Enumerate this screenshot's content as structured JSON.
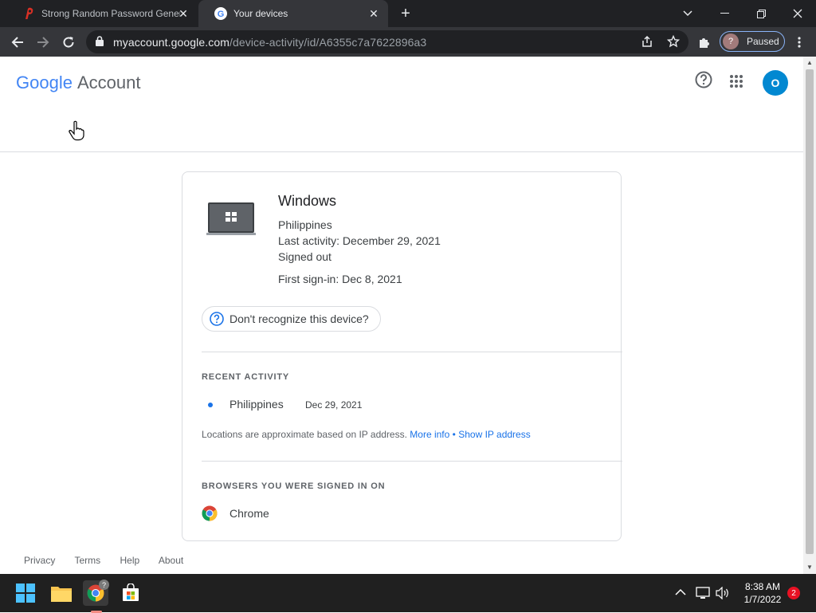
{
  "browser": {
    "tabs": [
      {
        "title": "Strong Random Password Generator",
        "active": false
      },
      {
        "title": "Your devices",
        "active": true
      }
    ],
    "url_host": "myaccount.google.com",
    "url_path": "/device-activity/id/A6355c7a7622896a3",
    "profile_initial": "?",
    "profile_status": "Paused"
  },
  "header": {
    "logo_google": "Google",
    "logo_account": "Account",
    "avatar_initial": "O"
  },
  "device": {
    "name": "Windows",
    "location": "Philippines",
    "last_activity": "Last activity: December 29, 2021",
    "status": "Signed out",
    "first_signin": "First sign-in: Dec 8, 2021",
    "recognize_label": "Don't recognize this device?"
  },
  "recent_activity": {
    "title": "RECENT ACTIVITY",
    "items": [
      {
        "location": "Philippines",
        "date": "Dec 29, 2021"
      }
    ],
    "note": "Locations are approximate based on IP address.",
    "more_info": "More info",
    "bullet": "•",
    "show_ip": "Show IP address"
  },
  "browsers": {
    "title": "BROWSERS YOU WERE SIGNED IN ON",
    "items": [
      {
        "name": "Chrome"
      }
    ]
  },
  "footer": {
    "links": [
      "Privacy",
      "Terms",
      "Help",
      "About"
    ]
  },
  "taskbar": {
    "time": "8:38 AM",
    "date": "1/7/2022",
    "notifications": "2",
    "chrome_badge": "?"
  },
  "colors": {
    "accent": "#1a73e8",
    "avatar": "#0288d1",
    "border": "#dadce0"
  }
}
